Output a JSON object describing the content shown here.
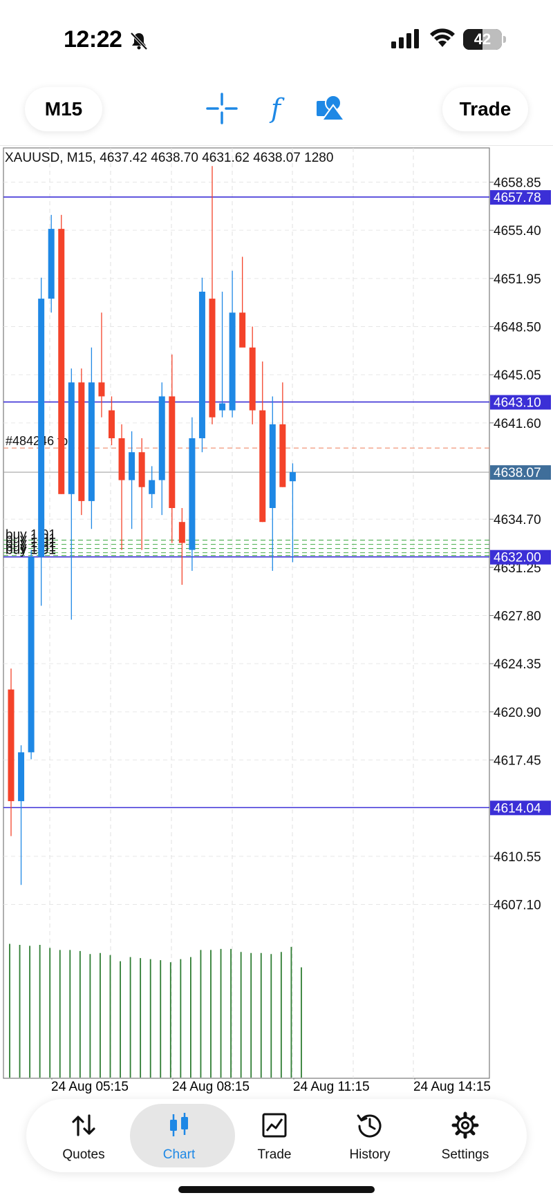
{
  "status_bar": {
    "time": "12:22",
    "battery": "42"
  },
  "toolbar": {
    "timeframe": "M15",
    "trade_label": "Trade"
  },
  "chart_header": {
    "symbol": "XAUUSD",
    "timeframe": "M15",
    "open": "4637.42",
    "high": "4638.70",
    "low": "4631.62",
    "close": "4638.07",
    "volume": "1280"
  },
  "chart_data": {
    "type": "candlestick",
    "y_ticks": [
      "4658.85",
      "4655.40",
      "4651.95",
      "4648.50",
      "4645.05",
      "4641.60",
      "4634.70",
      "4631.25",
      "4627.80",
      "4624.35",
      "4620.90",
      "4617.45",
      "4610.55",
      "4607.10"
    ],
    "x_ticks": [
      "24 Aug 05:15",
      "24 Aug 08:15",
      "24 Aug 11:15",
      "24 Aug 14:15"
    ],
    "ylim": [
      4604.6,
      4661.3
    ],
    "levels": [
      {
        "value": 4657.78,
        "label": "4657.78",
        "kind": "line"
      },
      {
        "value": 4643.1,
        "label": "4643.10",
        "kind": "line"
      },
      {
        "value": 4638.07,
        "label": "4638.07",
        "kind": "current"
      },
      {
        "value": 4632.0,
        "label": "4632.00",
        "kind": "line"
      },
      {
        "value": 4614.04,
        "label": "4614.04",
        "kind": "line"
      }
    ],
    "tp_level": {
      "value": 4639.8,
      "label": "#484246 tp"
    },
    "buy_label": "buy 1.01",
    "buy_levels": [
      4633.2,
      4632.9,
      4632.6,
      4632.3,
      4632.1
    ],
    "candles": [
      {
        "o": 4622.5,
        "h": 4624.0,
        "l": 4612.0,
        "c": 4614.5
      },
      {
        "o": 4614.5,
        "h": 4618.5,
        "l": 4608.5,
        "c": 4618.0
      },
      {
        "o": 4618.0,
        "h": 4632.5,
        "l": 4617.5,
        "c": 4632.0
      },
      {
        "o": 4632.0,
        "h": 4652.0,
        "l": 4628.5,
        "c": 4650.5
      },
      {
        "o": 4650.5,
        "h": 4656.5,
        "l": 4649.5,
        "c": 4655.5
      },
      {
        "o": 4655.5,
        "h": 4656.5,
        "l": 4636.5,
        "c": 4636.5
      },
      {
        "o": 4636.5,
        "h": 4645.5,
        "l": 4627.5,
        "c": 4644.5
      },
      {
        "o": 4644.5,
        "h": 4645.5,
        "l": 4635.0,
        "c": 4636.0
      },
      {
        "o": 4636.0,
        "h": 4647.0,
        "l": 4634.0,
        "c": 4644.5
      },
      {
        "o": 4644.5,
        "h": 4649.5,
        "l": 4642.0,
        "c": 4643.5
      },
      {
        "o": 4642.5,
        "h": 4643.5,
        "l": 4640.0,
        "c": 4640.5
      },
      {
        "o": 4640.5,
        "h": 4641.5,
        "l": 4632.5,
        "c": 4637.5
      },
      {
        "o": 4637.5,
        "h": 4641.0,
        "l": 4634.0,
        "c": 4639.5
      },
      {
        "o": 4639.5,
        "h": 4640.5,
        "l": 4632.5,
        "c": 4637.0
      },
      {
        "o": 4636.5,
        "h": 4638.5,
        "l": 4635.5,
        "c": 4637.5
      },
      {
        "o": 4637.5,
        "h": 4644.5,
        "l": 4635.0,
        "c": 4643.5
      },
      {
        "o": 4643.5,
        "h": 4646.5,
        "l": 4633.0,
        "c": 4635.5
      },
      {
        "o": 4634.5,
        "h": 4635.5,
        "l": 4630.0,
        "c": 4633.0
      },
      {
        "o": 4632.5,
        "h": 4642.0,
        "l": 4631.0,
        "c": 4640.5
      },
      {
        "o": 4640.5,
        "h": 4652.0,
        "l": 4639.5,
        "c": 4651.0
      },
      {
        "o": 4650.5,
        "h": 4660.0,
        "l": 4641.5,
        "c": 4642.0
      },
      {
        "o": 4642.5,
        "h": 4651.0,
        "l": 4642.0,
        "c": 4643.0
      },
      {
        "o": 4642.5,
        "h": 4652.5,
        "l": 4642.0,
        "c": 4649.5
      },
      {
        "o": 4649.5,
        "h": 4653.5,
        "l": 4647.5,
        "c": 4647.0
      },
      {
        "o": 4647.0,
        "h": 4648.5,
        "l": 4641.5,
        "c": 4642.5
      },
      {
        "o": 4642.5,
        "h": 4646.0,
        "l": 4634.5,
        "c": 4634.5
      },
      {
        "o": 4635.5,
        "h": 4643.5,
        "l": 4631.0,
        "c": 4641.5
      },
      {
        "o": 4641.5,
        "h": 4644.5,
        "l": 4637.0,
        "c": 4637.0
      },
      {
        "o": 4637.42,
        "h": 4638.7,
        "l": 4631.62,
        "c": 4638.07
      }
    ],
    "volumes": [
      1310,
      1300,
      1290,
      1300,
      1270,
      1250,
      1250,
      1240,
      1210,
      1220,
      1200,
      1140,
      1180,
      1170,
      1160,
      1150,
      1130,
      1160,
      1180,
      1250,
      1250,
      1260,
      1260,
      1230,
      1220,
      1220,
      1210,
      1230,
      1280,
      1080
    ]
  },
  "nav": {
    "items": [
      {
        "label": "Quotes"
      },
      {
        "label": "Chart"
      },
      {
        "label": "Trade"
      },
      {
        "label": "History"
      },
      {
        "label": "Settings"
      }
    ]
  },
  "colors": {
    "bull": "#1e88e5",
    "bear": "#f4432a",
    "level_line": "#3b2fd6",
    "level_label_bg": "#3b2fd6",
    "current_label_bg": "#3f6e9a",
    "volume": "#2e7d32",
    "tp": "#f08a6a",
    "buy": "#4caf50"
  }
}
